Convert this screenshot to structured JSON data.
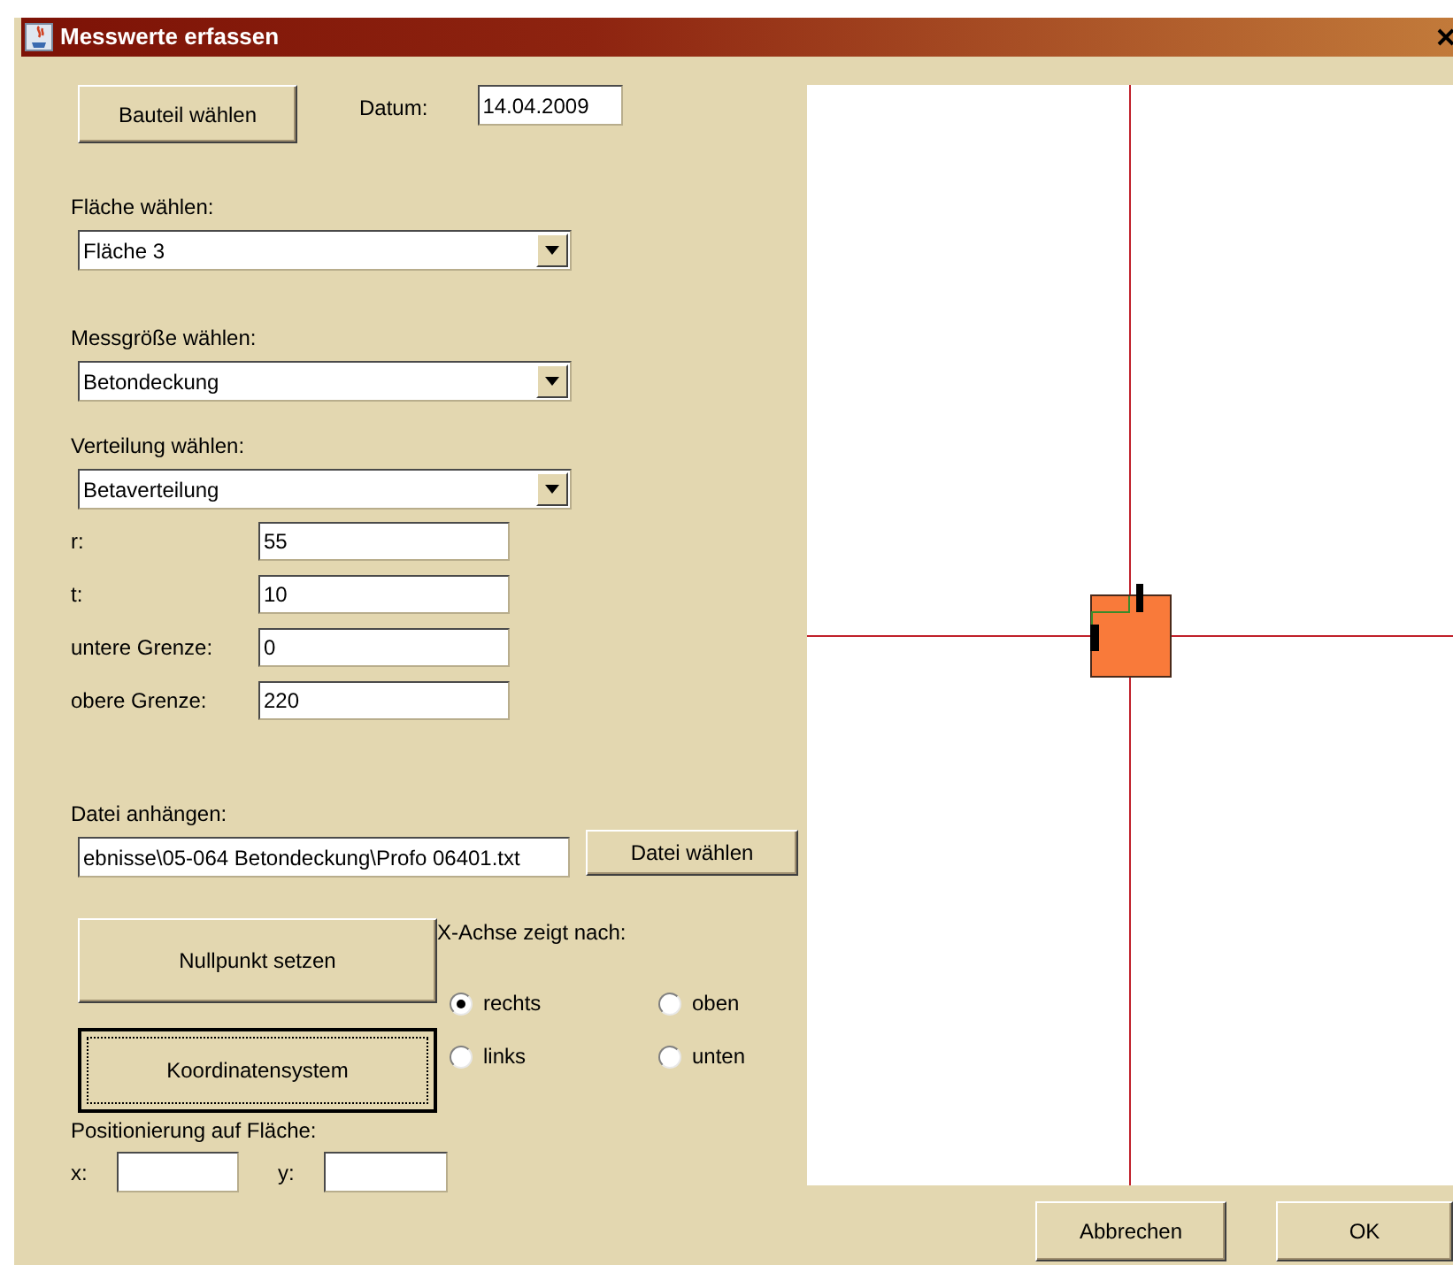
{
  "window": {
    "title": "Messwerte erfassen"
  },
  "part_button": "Bauteil wählen",
  "date": {
    "label": "Datum:",
    "value": "14.04.2009"
  },
  "selectors": [
    {
      "label": "Fläche wählen:",
      "value": "Fläche 3"
    },
    {
      "label": "Messgröße wählen:",
      "value": "Betondeckung"
    },
    {
      "label": "Verteilung wählen:",
      "value": "Betaverteilung"
    }
  ],
  "parameters": [
    {
      "label": "r:",
      "value": "55"
    },
    {
      "label": "t:",
      "value": "10"
    },
    {
      "label": "untere Grenze:",
      "value": "0"
    },
    {
      "label": "obere Grenze:",
      "value": "220"
    }
  ],
  "attachment": {
    "label": "Datei anhängen:",
    "value": "ebnisse\\05-064 Betondeckung\\Profo 06401.txt",
    "button": "Datei wählen"
  },
  "zero_button": {
    "label": "Nullpunkt setzen",
    "focused": false
  },
  "coord_button": {
    "label": "Koordinatensystem",
    "focused": true
  },
  "axis": {
    "label": "X-Achse zeigt nach:",
    "options": [
      {
        "label": "rechts",
        "selected": true
      },
      {
        "label": "oben",
        "selected": false
      },
      {
        "label": "links",
        "selected": false
      },
      {
        "label": "unten",
        "selected": false
      }
    ]
  },
  "positioning": {
    "label": "Positionierung auf Fläche:",
    "x_label": "x:",
    "y_label": "y:"
  },
  "buttons": [
    "Abbrechen",
    "OK"
  ]
}
